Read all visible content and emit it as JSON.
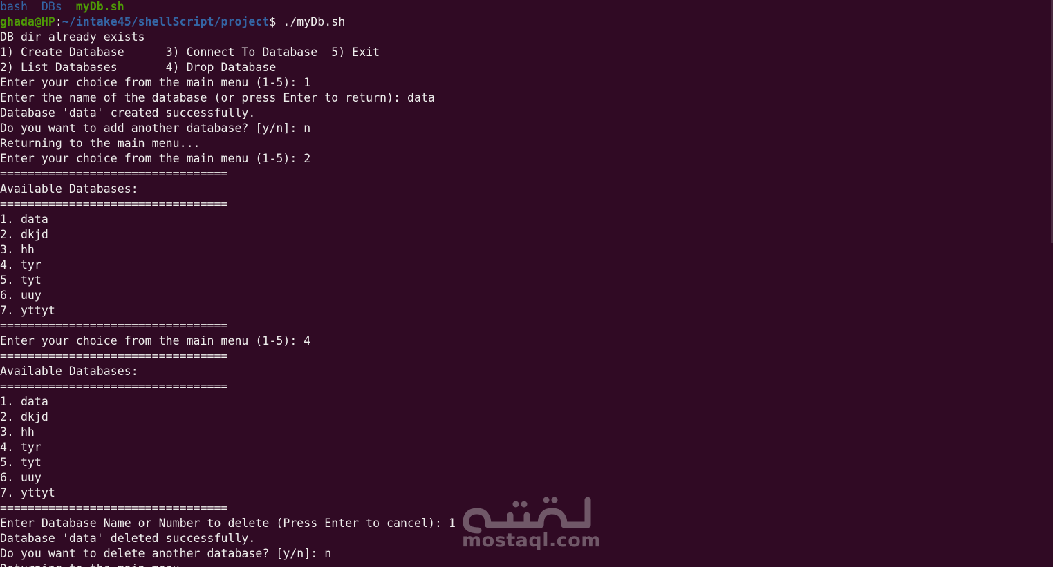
{
  "ls_output": {
    "dir1": "bash",
    "dir2": "DBs",
    "exec1": "myDb.sh"
  },
  "prompt": {
    "user_host": "ghada@HP",
    "colon": ":",
    "path": "~/intake45/shellScript/project",
    "dollar": "$ ",
    "command": "./myDb.sh"
  },
  "output_lines": [
    "DB dir already exists",
    "1) Create Database      3) Connect To Database  5) Exit",
    "2) List Databases       4) Drop Database",
    "Enter your choice from the main menu (1-5): 1",
    "Enter the name of the database (or press Enter to return): data",
    "Database 'data' created successfully.",
    "Do you want to add another database? [y/n]: n",
    "Returning to the main menu...",
    "Enter your choice from the main menu (1-5): 2",
    "=================================",
    "Available Databases:",
    "=================================",
    "1. data",
    "2. dkjd",
    "3. hh",
    "4. tyr",
    "5. tyt",
    "6. uuy",
    "7. yttyt",
    "=================================",
    "Enter your choice from the main menu (1-5): 4",
    "=================================",
    "Available Databases:",
    "=================================",
    "1. data",
    "2. dkjd",
    "3. hh",
    "4. tyr",
    "5. tyt",
    "6. uuy",
    "7. yttyt",
    "=================================",
    "Enter Database Name or Number to delete (Press Enter to cancel): 1",
    "Database 'data' deleted successfully.",
    "Do you want to delete another database? [y/n]: n",
    "Returning to the main menu..."
  ],
  "watermark": {
    "arabic": "مستقل",
    "latin": "mostaql.com"
  },
  "colors": {
    "background": "#300a24",
    "foreground": "#eeeeec",
    "green": "#4e9a06",
    "blue": "#3465a4"
  }
}
